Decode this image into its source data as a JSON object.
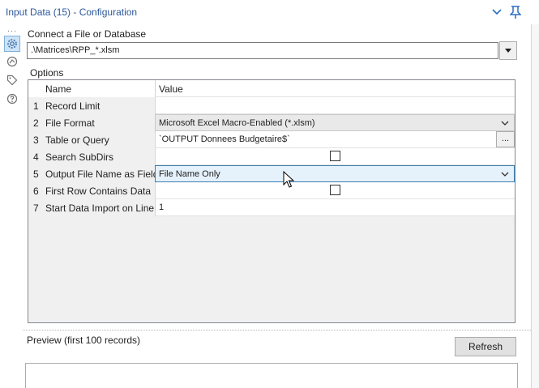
{
  "window": {
    "title": "Input Data (15) - Configuration"
  },
  "connect": {
    "label": "Connect a File or Database",
    "path_value": ".\\Matrices\\RPP_*.xlsm"
  },
  "options": {
    "label": "Options",
    "headers": {
      "name": "Name",
      "value": "Value"
    },
    "rows": [
      {
        "num": "1",
        "name": "Record Limit",
        "value": ""
      },
      {
        "num": "2",
        "name": "File Format",
        "value": "Microsoft Excel Macro-Enabled (*.xlsm)"
      },
      {
        "num": "3",
        "name": "Table or Query",
        "value": "`OUTPUT Donnees Budgetaire$`",
        "button": "..."
      },
      {
        "num": "4",
        "name": "Search SubDirs",
        "checked": false
      },
      {
        "num": "5",
        "name": "Output File Name as Field",
        "value": "File Name Only"
      },
      {
        "num": "6",
        "name": "First Row Contains Data",
        "checked": false
      },
      {
        "num": "7",
        "name": "Start Data Import on Line",
        "value": "1"
      }
    ]
  },
  "preview": {
    "label": "Preview (first 100 records)",
    "refresh_label": "Refresh"
  },
  "sidebar": {
    "dots": "...",
    "icons": [
      "gear-icon",
      "connection-icon",
      "tag-icon",
      "help-icon"
    ]
  },
  "colors": {
    "title": "#2b579a",
    "accent": "#2b6fbf",
    "active_combo": "#e5f1fb"
  }
}
